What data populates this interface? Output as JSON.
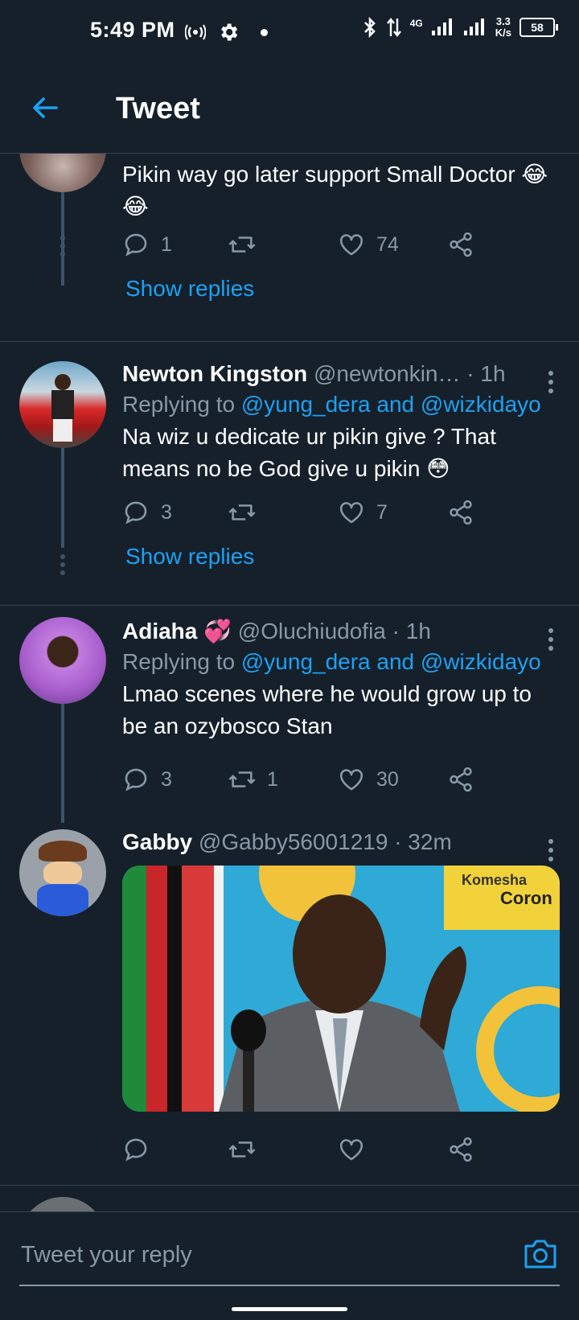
{
  "status_bar": {
    "time": "5:49 PM",
    "network": "4G",
    "speed_value": "3.3",
    "speed_unit": "K/s",
    "battery": "58"
  },
  "header": {
    "title": "Tweet"
  },
  "tweets": [
    {
      "body": "Pikin way go later support Small Doctor 😂😂",
      "replies": "1",
      "retweets": "",
      "likes": "74",
      "show_replies": "Show replies"
    },
    {
      "name": "Newton Kingston",
      "handle": "@newtonkin…",
      "time": "· 1h",
      "replying_prefix": "Replying to ",
      "replying_to": "@yung_dera and @wizkidayo",
      "body": "Na wiz u dedicate ur pikin give ? That means no be God give u pikin 😳",
      "replies": "3",
      "retweets": "",
      "likes": "7",
      "show_replies": "Show replies"
    },
    {
      "name": "Adiaha 💞",
      "handle": "@Oluchiudofia · 1h",
      "time": "",
      "replying_prefix": "Replying to ",
      "replying_to": "@yung_dera and @wizkidayo",
      "body": "Lmao scenes where he would grow up to be an ozybosco Stan",
      "replies": "3",
      "retweets": "1",
      "likes": "30"
    },
    {
      "name": "Gabby",
      "handle": "@Gabby56001219 · 32m",
      "time": "",
      "media_text_1": "Komesha",
      "media_text_2": "Coron",
      "replies": "",
      "retweets": "",
      "likes": ""
    }
  ],
  "reply_bar": {
    "placeholder": "Tweet your reply"
  },
  "colors": {
    "background": "#15202b",
    "accent": "#1da1f2",
    "muted": "#8899a6",
    "divider": "#38444d"
  }
}
